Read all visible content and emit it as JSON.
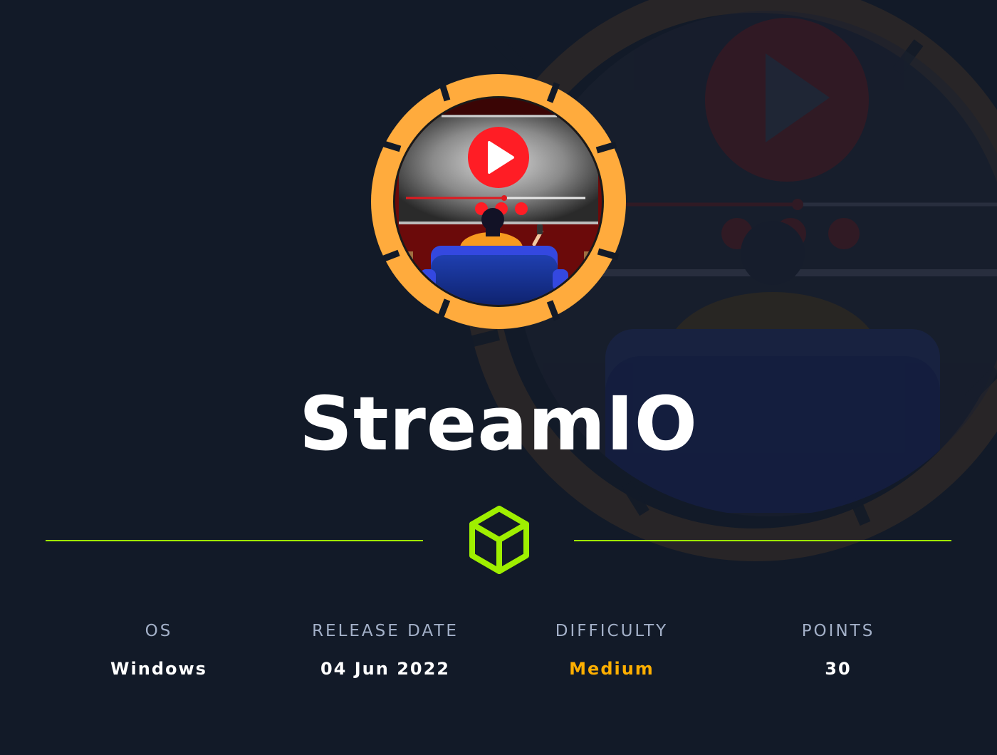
{
  "machine": {
    "name": "StreamIO"
  },
  "avatar": {
    "icon": "play-icon",
    "ring_color": "#ffab3d",
    "play_color": "#ff1d25"
  },
  "divider": {
    "icon": "cube-icon",
    "color": "#9fef00"
  },
  "stats": [
    {
      "label": "OS",
      "value": "Windows"
    },
    {
      "label": "RELEASE DATE",
      "value": "04 Jun 2022"
    },
    {
      "label": "DIFFICULTY",
      "value": "Medium",
      "color": "#ffaf00"
    },
    {
      "label": "POINTS",
      "value": "30"
    }
  ],
  "colors": {
    "background": "#121a28",
    "label": "#a3b0c8",
    "value": "#ffffff"
  }
}
